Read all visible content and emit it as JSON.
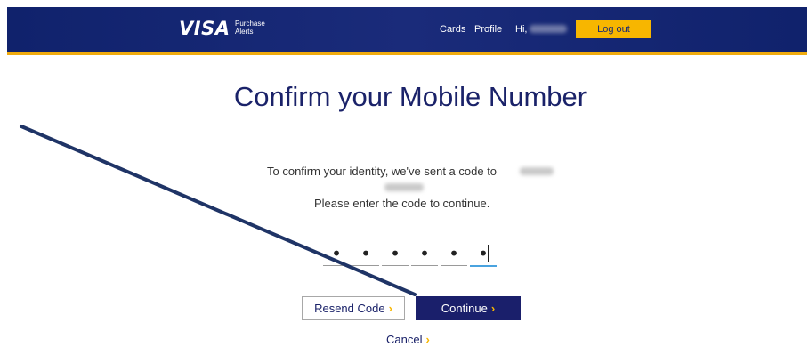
{
  "header": {
    "logo_text": "VISA",
    "logo_sub_line1": "Purchase",
    "logo_sub_line2": "Alerts",
    "nav_cards": "Cards",
    "nav_profile": "Profile",
    "greeting": "Hi,",
    "logout_label": "Log out"
  },
  "colors": {
    "header_bg": "#10226c",
    "accent": "#f7b600",
    "title": "#1a2269",
    "continue_bg": "#1a1f6b",
    "active_underline": "#4aa3df",
    "annotation_arrow": "#1f3466"
  },
  "main": {
    "title": "Confirm your Mobile Number",
    "message_line1": "To confirm your identity, we've sent a code to",
    "message_line2": "Please enter the code to continue.",
    "code_digits": [
      "•",
      "•",
      "•",
      "•",
      "•",
      "•"
    ],
    "resend_label": "Resend Code",
    "continue_label": "Continue",
    "cancel_label": "Cancel",
    "chevron": "›"
  }
}
